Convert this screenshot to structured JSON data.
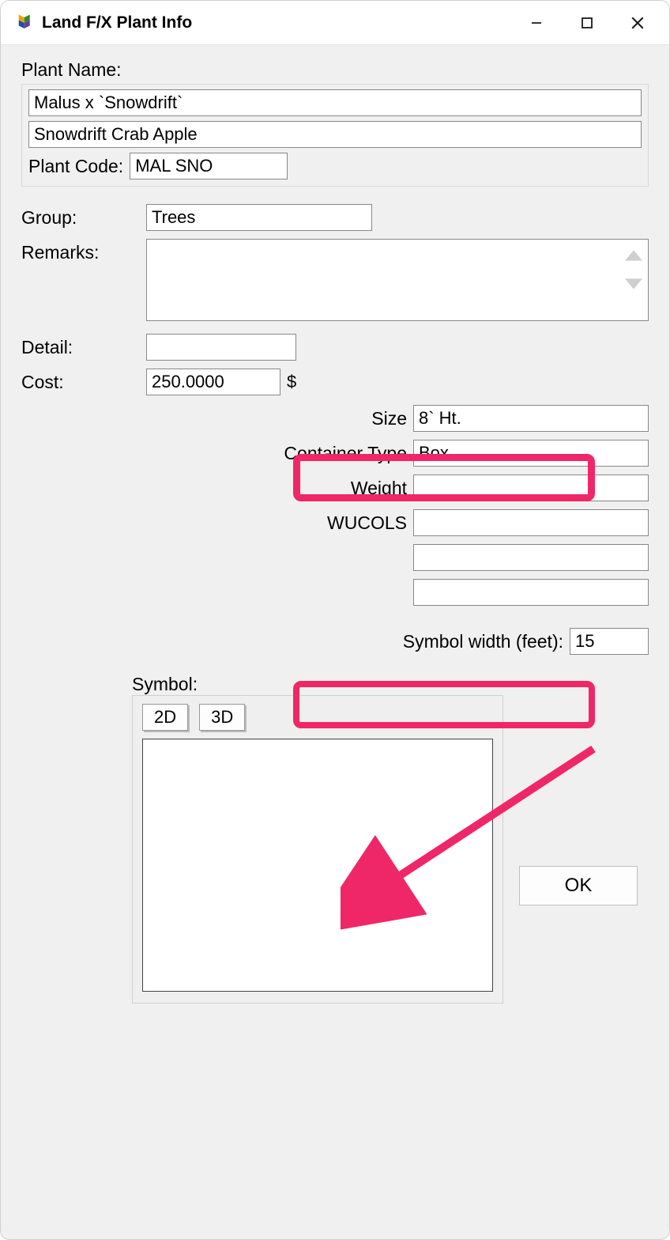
{
  "window": {
    "title": "Land F/X Plant Info"
  },
  "plant": {
    "name_label": "Plant Name:",
    "latin": "Malus x `Snowdrift`",
    "common": "Snowdrift Crab Apple",
    "code_label": "Plant Code:",
    "code": "MAL SNO"
  },
  "lefts": {
    "group_label": "Group:",
    "group": "Trees",
    "remarks_label": "Remarks:",
    "remarks": "",
    "detail_label": "Detail:",
    "detail": "",
    "cost_label": "Cost:",
    "cost": "250.0000",
    "cost_unit": "$"
  },
  "rights": {
    "size_label": "Size",
    "size": "8` Ht.",
    "container_label": "Container Type",
    "container": "Box",
    "weight_label": "Weight",
    "weight": "",
    "wucols_label": "WUCOLS",
    "wucols": "",
    "extra1": "",
    "extra2": ""
  },
  "symw": {
    "label": "Symbol width (feet):",
    "value": "15"
  },
  "symbol": {
    "label": "Symbol:",
    "tab2d": "2D",
    "tab3d": "3D"
  },
  "buttons": {
    "ok": "OK"
  }
}
